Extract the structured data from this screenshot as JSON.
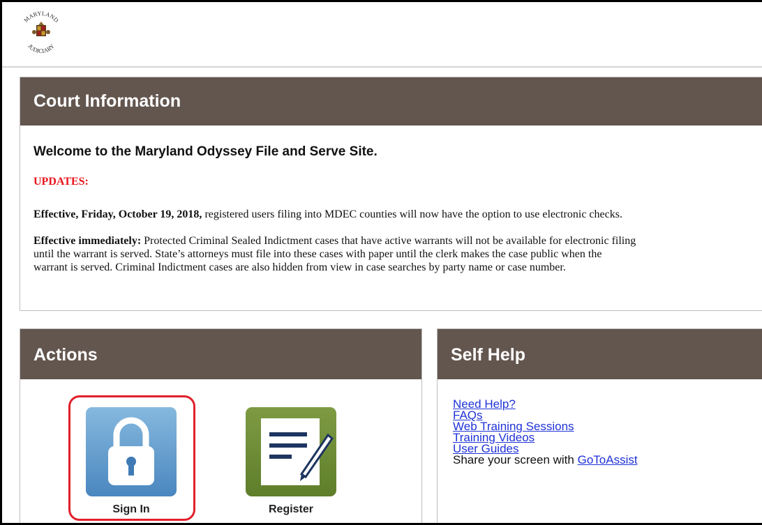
{
  "header": {
    "logo_text_top": "MARYLAND",
    "logo_text_bottom": "JUDICIARY"
  },
  "court": {
    "title": "Court Information",
    "welcome": "Welcome to the Maryland Odyssey File and Serve Site.",
    "updates_label": "UPDATES:",
    "update1": {
      "bold": "Effective, Friday, October 19, 2018,",
      "text": " registered users filing into MDEC counties will now have the option to use electronic checks."
    },
    "update2": {
      "bold": "Effective immediately:",
      "line1": " Protected Criminal Sealed Indictment cases that have active warrants will not be available for electronic filing",
      "line2": "until the warrant is served. State’s attorneys must file into these cases with paper until the clerk makes the case public when the",
      "line3": "warrant is served. Criminal Indictment cases are also hidden from view in case searches by party name or case number."
    }
  },
  "actions": {
    "title": "Actions",
    "sign_in_label": "Sign In",
    "register_label": "Register"
  },
  "self_help": {
    "title": "Self Help",
    "links": {
      "need_help": "Need Help?",
      "faqs": "FAQs",
      "web_training": "Web Training Sessions",
      "training_videos": "Training Videos",
      "user_guides": "User Guides"
    },
    "share_prefix": "Share your screen with ",
    "goto_assist": "GoToAssist"
  },
  "colors": {
    "panel_header": "#63564f",
    "updates_red": "#e8141b",
    "link_blue": "#1f32d6",
    "signin_blue": "#5d9ccf",
    "register_green": "#6f8c37",
    "highlight_red": "#e0202b"
  }
}
